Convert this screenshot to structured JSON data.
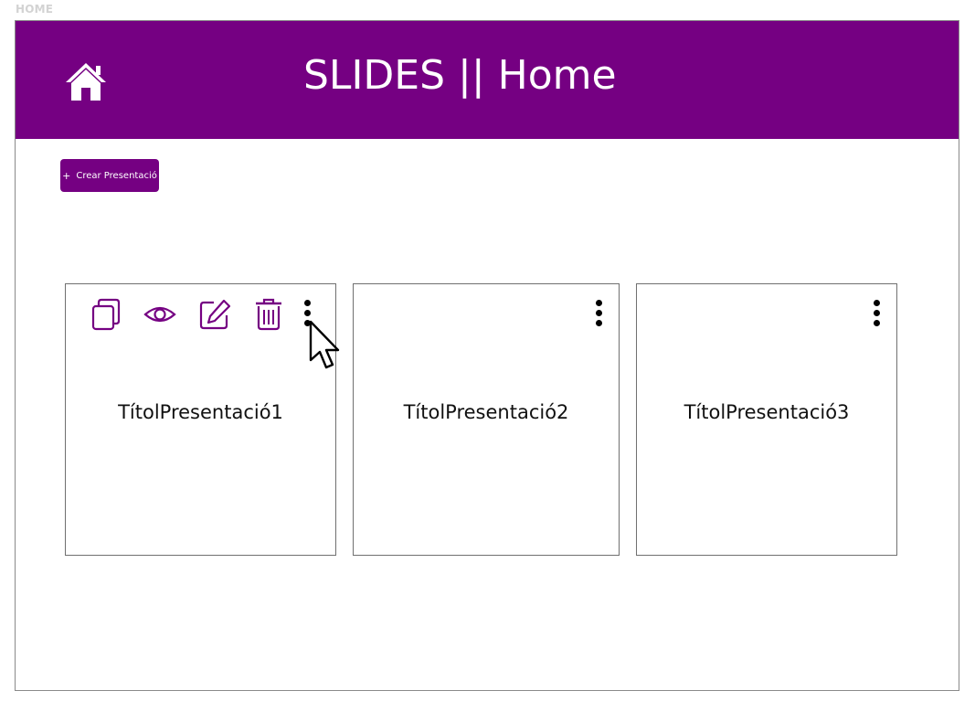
{
  "page_label": "HOME",
  "header": {
    "title": "SLIDES || Home",
    "home_icon": "home-icon"
  },
  "toolbar": {
    "create_label": "Crear Presentació",
    "create_icon": "+"
  },
  "presentations": [
    {
      "title": "TítolPresentació1",
      "actions_visible": true
    },
    {
      "title": "TítolPresentació2",
      "actions_visible": false
    },
    {
      "title": "TítolPresentació3",
      "actions_visible": false
    }
  ],
  "card_actions": [
    "copy-icon",
    "eye-icon",
    "edit-icon",
    "trash-icon"
  ],
  "colors": {
    "brand": "#750082",
    "header_text": "#ffffff",
    "border": "#707070"
  }
}
